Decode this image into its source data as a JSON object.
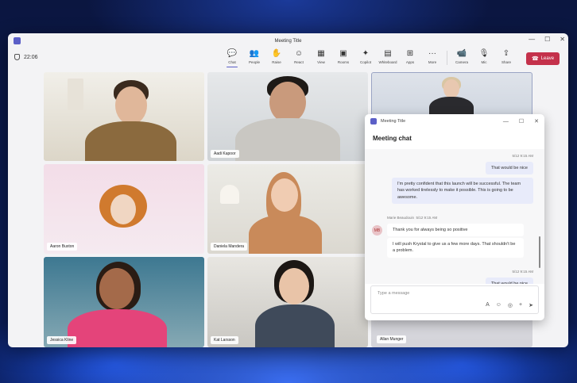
{
  "window": {
    "title": "Meeting Title",
    "timer": "22:06"
  },
  "toolbar": {
    "tools": [
      {
        "label": "Chat",
        "icon": "chat-icon",
        "glyph": "💬"
      },
      {
        "label": "People",
        "icon": "people-icon",
        "glyph": "👥"
      },
      {
        "label": "Raise",
        "icon": "hand-icon",
        "glyph": "✋"
      },
      {
        "label": "React",
        "icon": "smile-icon",
        "glyph": "☺"
      },
      {
        "label": "View",
        "icon": "grid-icon",
        "glyph": "▦"
      },
      {
        "label": "Rooms",
        "icon": "rooms-icon",
        "glyph": "▣"
      },
      {
        "label": "Copilot",
        "icon": "copilot-icon",
        "glyph": "✦"
      },
      {
        "label": "Whiteboard",
        "icon": "whiteboard-icon",
        "glyph": "▤"
      },
      {
        "label": "Apps",
        "icon": "apps-icon",
        "glyph": "⊞"
      },
      {
        "label": "More",
        "icon": "more-icon",
        "glyph": "···"
      }
    ],
    "camera_label": "Camera",
    "mic_label": "Mic",
    "share_label": "Share",
    "leave_label": "Leave"
  },
  "participants": [
    {
      "name": ""
    },
    {
      "name": "Aadi Kapoor"
    },
    {
      "name": ""
    },
    {
      "name": "Aaron Buxton"
    },
    {
      "name": "Daniela Mandera"
    },
    {
      "name": "Jessica Kline"
    },
    {
      "name": "Kat Larsson"
    },
    {
      "name": "Allan Munger"
    }
  ],
  "chat": {
    "window_title": "Meeting Title",
    "header": "Meeting chat",
    "messages": {
      "m1_time": "5/12 9:15 AM",
      "m1_text": "That would be nice",
      "m2_text": "I'm pretty confident that this launch will be successful. The team has worked tirelessly to make it possible. This is going to be awesome.",
      "m3_sender": "Marie Beaudouin",
      "m3_time": "5/12 9:15 AM",
      "m3_text": "Thank you for always being so positive",
      "m4_text": "I will push Krystal to give us a few more days. That shouldn't be a problem.",
      "m5_time": "5/12 9:15 AM",
      "m5_text": "That would be nice",
      "avatar_initials": "MB"
    },
    "compose_placeholder": "Type a message"
  },
  "colors": {
    "accent": "#5b5fc7",
    "leave": "#c4314b",
    "my_bubble": "#e8ebfa"
  }
}
